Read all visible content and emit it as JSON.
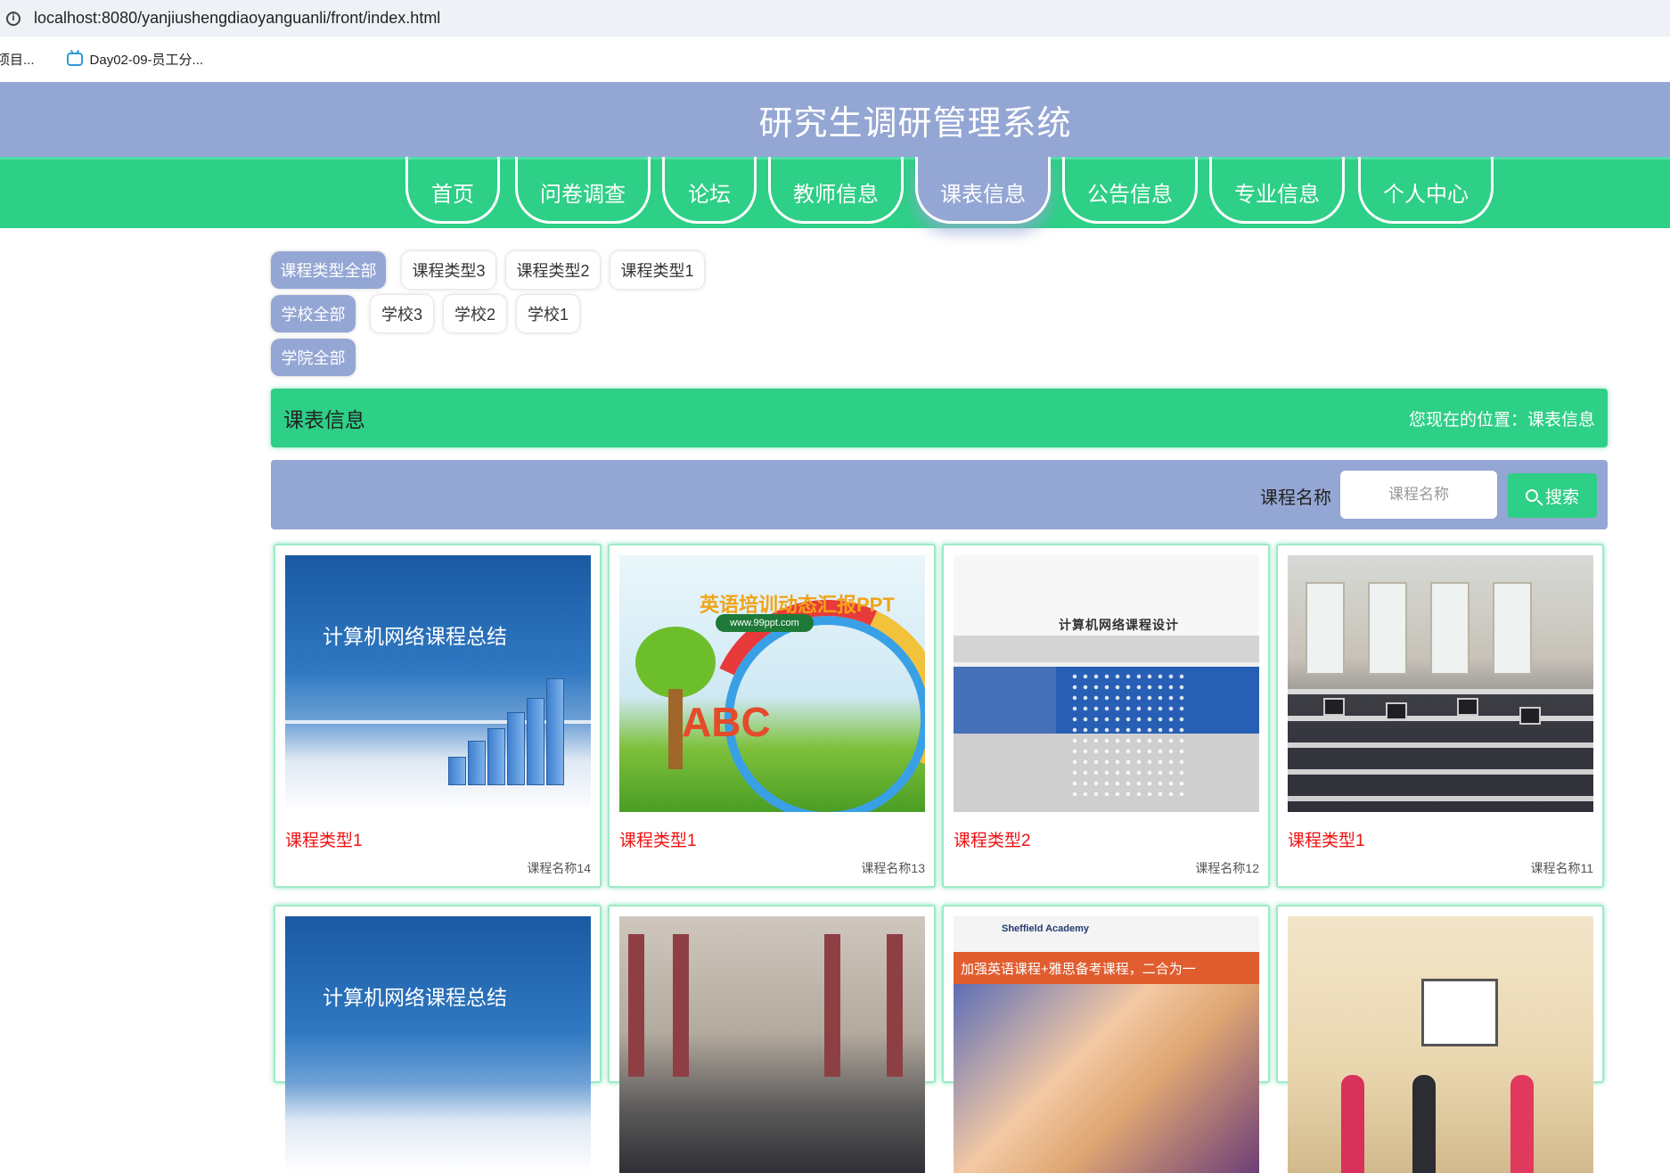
{
  "browser": {
    "url": "localhost:8080/yanjiushengdiaoyanguanli/front/index.html",
    "bookmarks": [
      "项目...",
      "Day02-09-员工分..."
    ]
  },
  "site": {
    "title": "研究生调研管理系统"
  },
  "nav": {
    "items": [
      "首页",
      "问卷调查",
      "论坛",
      "教师信息",
      "课表信息",
      "公告信息",
      "专业信息",
      "个人中心"
    ],
    "active": "课表信息"
  },
  "filters": {
    "course_type": [
      "课程类型全部",
      "课程类型3",
      "课程类型2",
      "课程类型1"
    ],
    "school": [
      "学校全部",
      "学校3",
      "学校2",
      "学校1"
    ],
    "college": [
      "学院全部"
    ]
  },
  "section": {
    "title": "课表信息",
    "breadcrumb_prefix": "您现在的位置：",
    "breadcrumb_current": "课表信息"
  },
  "search": {
    "label": "课程名称",
    "placeholder": "课程名称",
    "button": "搜索"
  },
  "cards": [
    {
      "type": "课程类型1",
      "name": "课程名称14",
      "image_text": "计算机网络课程总结"
    },
    {
      "type": "课程类型1",
      "name": "课程名称13",
      "image_text": "英语培训动态汇报PPT",
      "image_subtext": "www.99ppt.com"
    },
    {
      "type": "课程类型2",
      "name": "课程名称12",
      "image_text": "计算机网络课程设计"
    },
    {
      "type": "课程类型1",
      "name": "课程名称11"
    },
    {
      "image_text": "计算机网络课程总结"
    },
    {},
    {
      "image_text": "加强英语课程+雅思备考课程，二合为一",
      "image_subtext": "Sheffield Academy"
    },
    {}
  ],
  "colors": {
    "header": "#94a6d3",
    "nav": "#2ecf86",
    "accent_red": "#ee1111"
  }
}
